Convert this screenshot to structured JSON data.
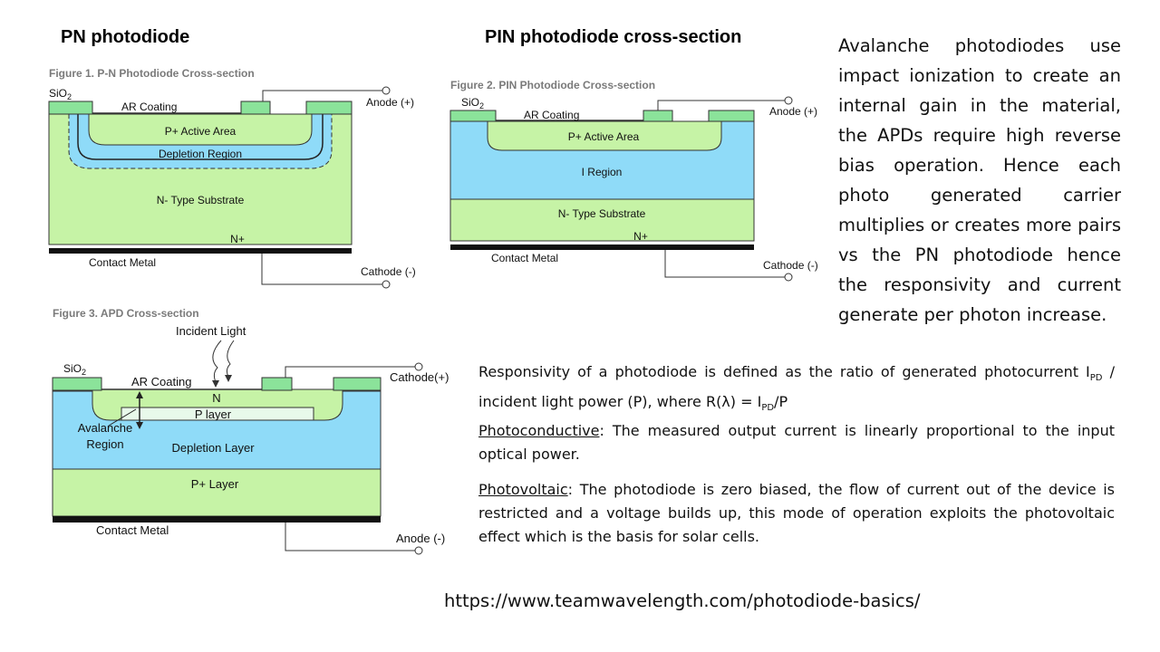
{
  "headings": {
    "pn": "PN photodiode",
    "pin": "PIN photodiode cross-section"
  },
  "figure1": {
    "caption": "Figure 1. P-N Photodiode Cross-section",
    "sio2": "SiO",
    "sio2_sub": "2",
    "ar_coating": "AR Coating",
    "anode": "Anode (+)",
    "p_active": "P+ Active Area",
    "depletion": "Depletion Region",
    "substrate": "N- Type Substrate",
    "nplus": "N+",
    "contact": "Contact Metal",
    "cathode": "Cathode (-)"
  },
  "figure2": {
    "caption": "Figure 2. PIN Photodiode Cross-section",
    "sio2": "SiO",
    "sio2_sub": "2",
    "ar_coating": "AR Coating",
    "anode": "Anode (+)",
    "p_active": "P+ Active Area",
    "i_region": "I Region",
    "substrate": "N- Type Substrate",
    "nplus": "N+",
    "contact": "Contact Metal",
    "cathode": "Cathode (-)"
  },
  "figure3": {
    "caption": "Figure 3. APD Cross-section",
    "incident": "Incident Light",
    "sio2": "SiO",
    "sio2_sub": "2",
    "ar_coating": "AR Coating",
    "cathode": "Cathode(+)",
    "n": "N",
    "p_layer": "P layer",
    "avalanche_1": "Avalanche",
    "avalanche_2": "Region",
    "depletion": "Depletion Layer",
    "pplus": "P+ Layer",
    "contact": "Contact Metal",
    "anode": "Anode (-)"
  },
  "apd_paragraph": "Avalanche photodiodes use impact ionization to create an internal gain in the material, the APDs require high reverse bias operation.  Hence each photo generated carrier multiplies or creates more pairs vs the PN photodiode hence the responsivity and current generate per photon increase.",
  "responsivity": {
    "text_a": "Responsivity of a photodiode is defined as the ratio of generated photocurrent I",
    "sub_a": "PD",
    "text_b": " / incident light power (P), where R(λ) = I",
    "sub_b": "PD",
    "text_c": "/P"
  },
  "photoconductive": {
    "term": "Photoconductive",
    "text": ": The measured output current is linearly proportional to the input optical power."
  },
  "photovoltaic": {
    "term": "Photovoltaic",
    "text": ": The photodiode is zero biased, the flow of current out of the device is restricted and a voltage builds up, this mode of operation exploits the photovoltaic effect which is the basis for solar cells."
  },
  "url": "https://www.teamwavelength.com/photodiode-basics/",
  "colors": {
    "green": "#c6f3a6",
    "blue": "#8fdbf8",
    "oxide": "#8be39a",
    "metal": "#111111"
  }
}
